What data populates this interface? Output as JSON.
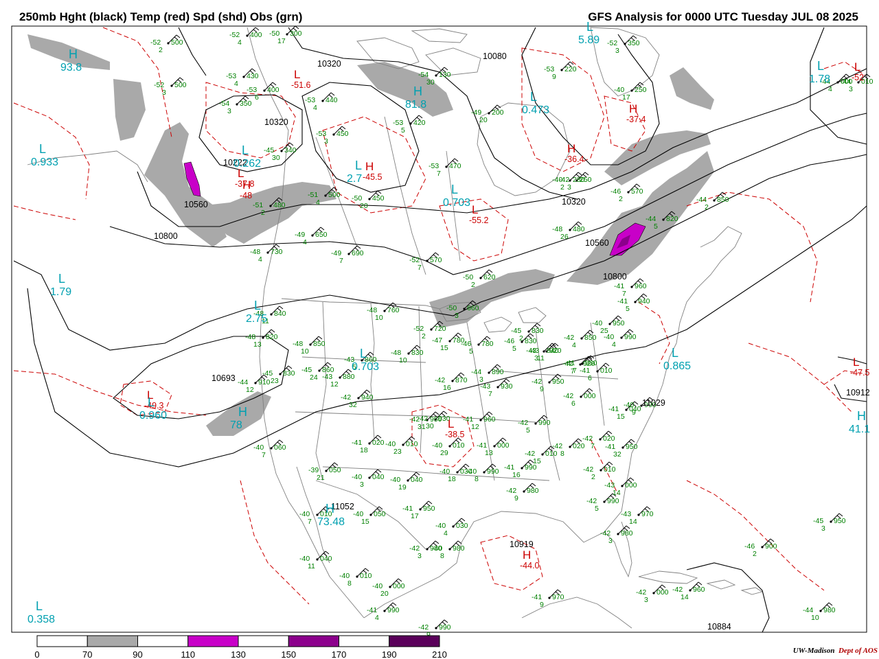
{
  "header": {
    "title_left": "250mb Hght (black) Temp (red) Spd (shd) Obs (grn)",
    "title_right": "GFS Analysis for 0000 UTC Tuesday  JUL 08 2025"
  },
  "colors": {
    "height_contour": "#000000",
    "temperature_contour": "#cc0000",
    "observation_text": "#008000",
    "speed_shading_70_90": "#a9a9a9",
    "speed_shading_110_130": "#c800c8",
    "speed_shading_150_170": "#8c008c",
    "speed_shading_190_210": "#5a005a",
    "center_label": "#00a0b0",
    "geography": "#808080"
  },
  "legend": {
    "ticks": [
      "0",
      "70",
      "90",
      "110",
      "130",
      "150",
      "170",
      "190",
      "210"
    ],
    "bins": [
      {
        "range": "0-70",
        "color": "#ffffff"
      },
      {
        "range": "70-90",
        "color": "#a9a9a9"
      },
      {
        "range": "90-110",
        "color": "#ffffff"
      },
      {
        "range": "110-130",
        "color": "#c800c8"
      },
      {
        "range": "130-150",
        "color": "#ffffff"
      },
      {
        "range": "150-170",
        "color": "#8c008c"
      },
      {
        "range": "170-190",
        "color": "#ffffff"
      },
      {
        "range": "190-210",
        "color": "#5a005a"
      }
    ]
  },
  "height_labels": [
    "10320",
    "10320",
    "10320",
    "10560",
    "10800",
    "10693",
    "11052",
    "10919",
    "10080",
    "10560",
    "10800",
    "11029",
    "10884",
    "10912",
    "10222"
  ],
  "temp_centers": [
    {
      "letter": "L",
      "value": "-37.8"
    },
    {
      "letter": "H",
      "value": "-48"
    },
    {
      "letter": "L",
      "value": "-51.6"
    },
    {
      "letter": "H",
      "value": "-45.5"
    },
    {
      "letter": "L",
      "value": "-55.2"
    },
    {
      "letter": "H",
      "value": "-37.4"
    },
    {
      "letter": "H",
      "value": "-36.4"
    },
    {
      "letter": "L",
      "value": "-49.3"
    },
    {
      "letter": "L",
      "value": "-38.5"
    },
    {
      "letter": "H",
      "value": "-44.0"
    },
    {
      "letter": "L",
      "value": "-47.5"
    },
    {
      "letter": "L",
      "value": "-52"
    }
  ],
  "speed_centers": [
    {
      "letter": "H",
      "value": "93.8"
    },
    {
      "letter": "L",
      "value": "0.933"
    },
    {
      "letter": "L",
      "value": "1.79"
    },
    {
      "letter": "L",
      "value": "2.75"
    },
    {
      "letter": "L",
      "value": "0.960"
    },
    {
      "letter": "H",
      "value": "78"
    },
    {
      "letter": "L",
      "value": "0.703"
    },
    {
      "letter": "L",
      "value": "0.703"
    },
    {
      "letter": "L",
      "value": "0.865"
    },
    {
      "letter": "L",
      "value": "1.78"
    },
    {
      "letter": "H",
      "value": "81.8"
    },
    {
      "letter": "L",
      "value": "0.473"
    },
    {
      "letter": "L",
      "value": "5.89"
    },
    {
      "letter": "L",
      "value": "0.358"
    },
    {
      "letter": "H",
      "value": "73.48"
    },
    {
      "letter": "H",
      "value": "41.1"
    },
    {
      "letter": "L",
      "value": "0.262"
    },
    {
      "letter": "L",
      "value": "2.7"
    }
  ],
  "observations": [
    {
      "temp": "-52",
      "height": "400",
      "dewpt": "4"
    },
    {
      "temp": "-52",
      "height": "500",
      "dewpt": "2"
    },
    {
      "temp": "-52",
      "height": "500",
      "dewpt": "3"
    },
    {
      "temp": "-53",
      "height": "430",
      "dewpt": "4"
    },
    {
      "temp": "-53",
      "height": "400",
      "dewpt": "6"
    },
    {
      "temp": "-54",
      "height": "350",
      "dewpt": "3"
    },
    {
      "temp": "-50",
      "height": "300",
      "dewpt": "17"
    },
    {
      "temp": "-53",
      "height": "440",
      "dewpt": "4"
    },
    {
      "temp": "-53",
      "height": "450",
      "dewpt": "3"
    },
    {
      "temp": "-53",
      "height": "420",
      "dewpt": "5"
    },
    {
      "temp": "-54",
      "height": "130",
      "dewpt": "30"
    },
    {
      "temp": "-49",
      "height": "200",
      "dewpt": "20"
    },
    {
      "temp": "-53",
      "height": "220",
      "dewpt": "9"
    },
    {
      "temp": "-52",
      "height": "350",
      "dewpt": "3"
    },
    {
      "temp": "-40",
      "height": "250",
      "dewpt": "17"
    },
    {
      "temp": "-53",
      "height": "470",
      "dewpt": "7"
    },
    {
      "temp": "-42",
      "height": "250",
      "dewpt": "3"
    },
    {
      "temp": "-45",
      "height": "340",
      "dewpt": "30"
    },
    {
      "temp": "-51",
      "height": "500",
      "dewpt": "4"
    },
    {
      "temp": "-50",
      "height": "450",
      "dewpt": "20"
    },
    {
      "temp": "-51",
      "height": "480",
      "dewpt": "2"
    },
    {
      "temp": "-49",
      "height": "650",
      "dewpt": "4"
    },
    {
      "temp": "-48",
      "height": "730",
      "dewpt": "4"
    },
    {
      "temp": "-49",
      "height": "690",
      "dewpt": "7"
    },
    {
      "temp": "-52",
      "height": "570",
      "dewpt": "7"
    },
    {
      "temp": "-40",
      "height": "280",
      "dewpt": "2"
    },
    {
      "temp": "-46",
      "height": "570",
      "dewpt": "2"
    },
    {
      "temp": "-44",
      "height": "850",
      "dewpt": "2"
    },
    {
      "temp": "-44",
      "height": "820",
      "dewpt": "5"
    },
    {
      "temp": "-48",
      "height": "480",
      "dewpt": "26"
    },
    {
      "temp": "-50",
      "height": "620",
      "dewpt": "2"
    },
    {
      "temp": "-50",
      "height": "660",
      "dewpt": "3"
    },
    {
      "temp": "-48",
      "height": "760",
      "dewpt": "10"
    },
    {
      "temp": "-48",
      "height": "840",
      "dewpt": "11"
    },
    {
      "temp": "-48",
      "height": "820",
      "dewpt": "13"
    },
    {
      "temp": "-48",
      "height": "850",
      "dewpt": "10"
    },
    {
      "temp": "-48",
      "height": "830",
      "dewpt": "10"
    },
    {
      "temp": "-43",
      "height": "860",
      "dewpt": "5"
    },
    {
      "temp": "-52",
      "height": "720",
      "dewpt": "2"
    },
    {
      "temp": "-47",
      "height": "780",
      "dewpt": "15"
    },
    {
      "temp": "-46",
      "height": "780",
      "dewpt": "5"
    },
    {
      "temp": "-46",
      "height": "830",
      "dewpt": "5"
    },
    {
      "temp": "-45",
      "height": "830",
      "dewpt": "2"
    },
    {
      "temp": "-43",
      "height": "840",
      "dewpt": "3"
    },
    {
      "temp": "-42",
      "height": "850",
      "dewpt": "4"
    },
    {
      "temp": "-41",
      "height": "940",
      "dewpt": "5"
    },
    {
      "temp": "-41",
      "height": "960",
      "dewpt": "7"
    },
    {
      "temp": "-40",
      "height": "950",
      "dewpt": "25"
    },
    {
      "temp": "-40",
      "height": "990",
      "dewpt": "4"
    },
    {
      "temp": "-42",
      "height": "920",
      "dewpt": "7"
    },
    {
      "temp": "-43",
      "height": "920",
      "dewpt": "11"
    },
    {
      "temp": "-45",
      "height": "830",
      "dewpt": "23"
    },
    {
      "temp": "-45",
      "height": "860",
      "dewpt": "24"
    },
    {
      "temp": "-43",
      "height": "880",
      "dewpt": "12"
    },
    {
      "temp": "-44",
      "height": "910",
      "dewpt": "12"
    },
    {
      "temp": "-42",
      "height": "940",
      "dewpt": "32"
    },
    {
      "temp": "-42",
      "height": "870",
      "dewpt": "16"
    },
    {
      "temp": "-44",
      "height": "890",
      "dewpt": "3"
    },
    {
      "temp": "-43",
      "height": "930",
      "dewpt": "7"
    },
    {
      "temp": "-42",
      "height": "950",
      "dewpt": "9"
    },
    {
      "temp": "-41",
      "height": "960",
      "dewpt": "7"
    },
    {
      "temp": "-41",
      "height": "010",
      "dewpt": "6"
    },
    {
      "temp": "-42",
      "height": "000",
      "dewpt": "6"
    },
    {
      "temp": "-41",
      "height": "040",
      "dewpt": "15"
    },
    {
      "temp": "-40",
      "height": "990",
      "dewpt": "9"
    },
    {
      "temp": "-41",
      "height": "950",
      "dewpt": "32"
    },
    {
      "temp": "-42",
      "height": "930",
      "dewpt": "30"
    },
    {
      "temp": "-42",
      "height": "950",
      "dewpt": "31"
    },
    {
      "temp": "-41",
      "height": "960",
      "dewpt": "12"
    },
    {
      "temp": "-42",
      "height": "990",
      "dewpt": "5"
    },
    {
      "temp": "-41",
      "height": "020",
      "dewpt": "18"
    },
    {
      "temp": "-40",
      "height": "010",
      "dewpt": "23"
    },
    {
      "temp": "-40",
      "height": "010",
      "dewpt": "29"
    },
    {
      "temp": "-41",
      "height": "000",
      "dewpt": "13"
    },
    {
      "temp": "-42",
      "height": "010",
      "dewpt": "15"
    },
    {
      "temp": "-42",
      "height": "020",
      "dewpt": "8"
    },
    {
      "temp": "-42",
      "height": "020",
      "dewpt": "7"
    },
    {
      "temp": "-39",
      "height": "050",
      "dewpt": "21"
    },
    {
      "temp": "-40",
      "height": "040",
      "dewpt": "3"
    },
    {
      "temp": "-40",
      "height": "040",
      "dewpt": "19"
    },
    {
      "temp": "-40",
      "height": "030",
      "dewpt": "18"
    },
    {
      "temp": "-40",
      "height": "990",
      "dewpt": "8"
    },
    {
      "temp": "-41",
      "height": "990",
      "dewpt": "16"
    },
    {
      "temp": "-42",
      "height": "980",
      "dewpt": "9"
    },
    {
      "temp": "-42",
      "height": "010",
      "dewpt": "2"
    },
    {
      "temp": "-43",
      "height": "000",
      "dewpt": "14"
    },
    {
      "temp": "-42",
      "height": "990",
      "dewpt": "5"
    },
    {
      "temp": "-43",
      "height": "970",
      "dewpt": "14"
    },
    {
      "temp": "-42",
      "height": "980",
      "dewpt": "3"
    },
    {
      "temp": "-41",
      "height": "950",
      "dewpt": "17"
    },
    {
      "temp": "-40",
      "height": "030",
      "dewpt": "4"
    },
    {
      "temp": "-40",
      "height": "980",
      "dewpt": "8"
    },
    {
      "temp": "-42",
      "height": "980",
      "dewpt": "3"
    },
    {
      "temp": "-40",
      "height": "010",
      "dewpt": "7"
    },
    {
      "temp": "-40",
      "height": "050",
      "dewpt": "15"
    },
    {
      "temp": "-40",
      "height": "060",
      "dewpt": "7"
    },
    {
      "temp": "-40",
      "height": "040",
      "dewpt": "11"
    },
    {
      "temp": "-40",
      "height": "010",
      "dewpt": "8"
    },
    {
      "temp": "-40",
      "height": "000",
      "dewpt": "20"
    },
    {
      "temp": "-41",
      "height": "990",
      "dewpt": "4"
    },
    {
      "temp": "-42",
      "height": "990",
      "dewpt": "9"
    },
    {
      "temp": "-41",
      "height": "970",
      "dewpt": "9"
    },
    {
      "temp": "-42",
      "height": "000",
      "dewpt": "3"
    },
    {
      "temp": "-42",
      "height": "960",
      "dewpt": "14"
    },
    {
      "temp": "-46",
      "height": "900",
      "dewpt": "2"
    },
    {
      "temp": "-45",
      "height": "950",
      "dewpt": "3"
    },
    {
      "temp": "-44",
      "height": "980",
      "dewpt": "10"
    },
    {
      "temp": "-44",
      "height": "000",
      "dewpt": "4"
    },
    {
      "temp": "-44",
      "height": "010",
      "dewpt": "3"
    }
  ],
  "credit": {
    "org": "UW-Madison",
    "dept": "Dept of AOS"
  }
}
